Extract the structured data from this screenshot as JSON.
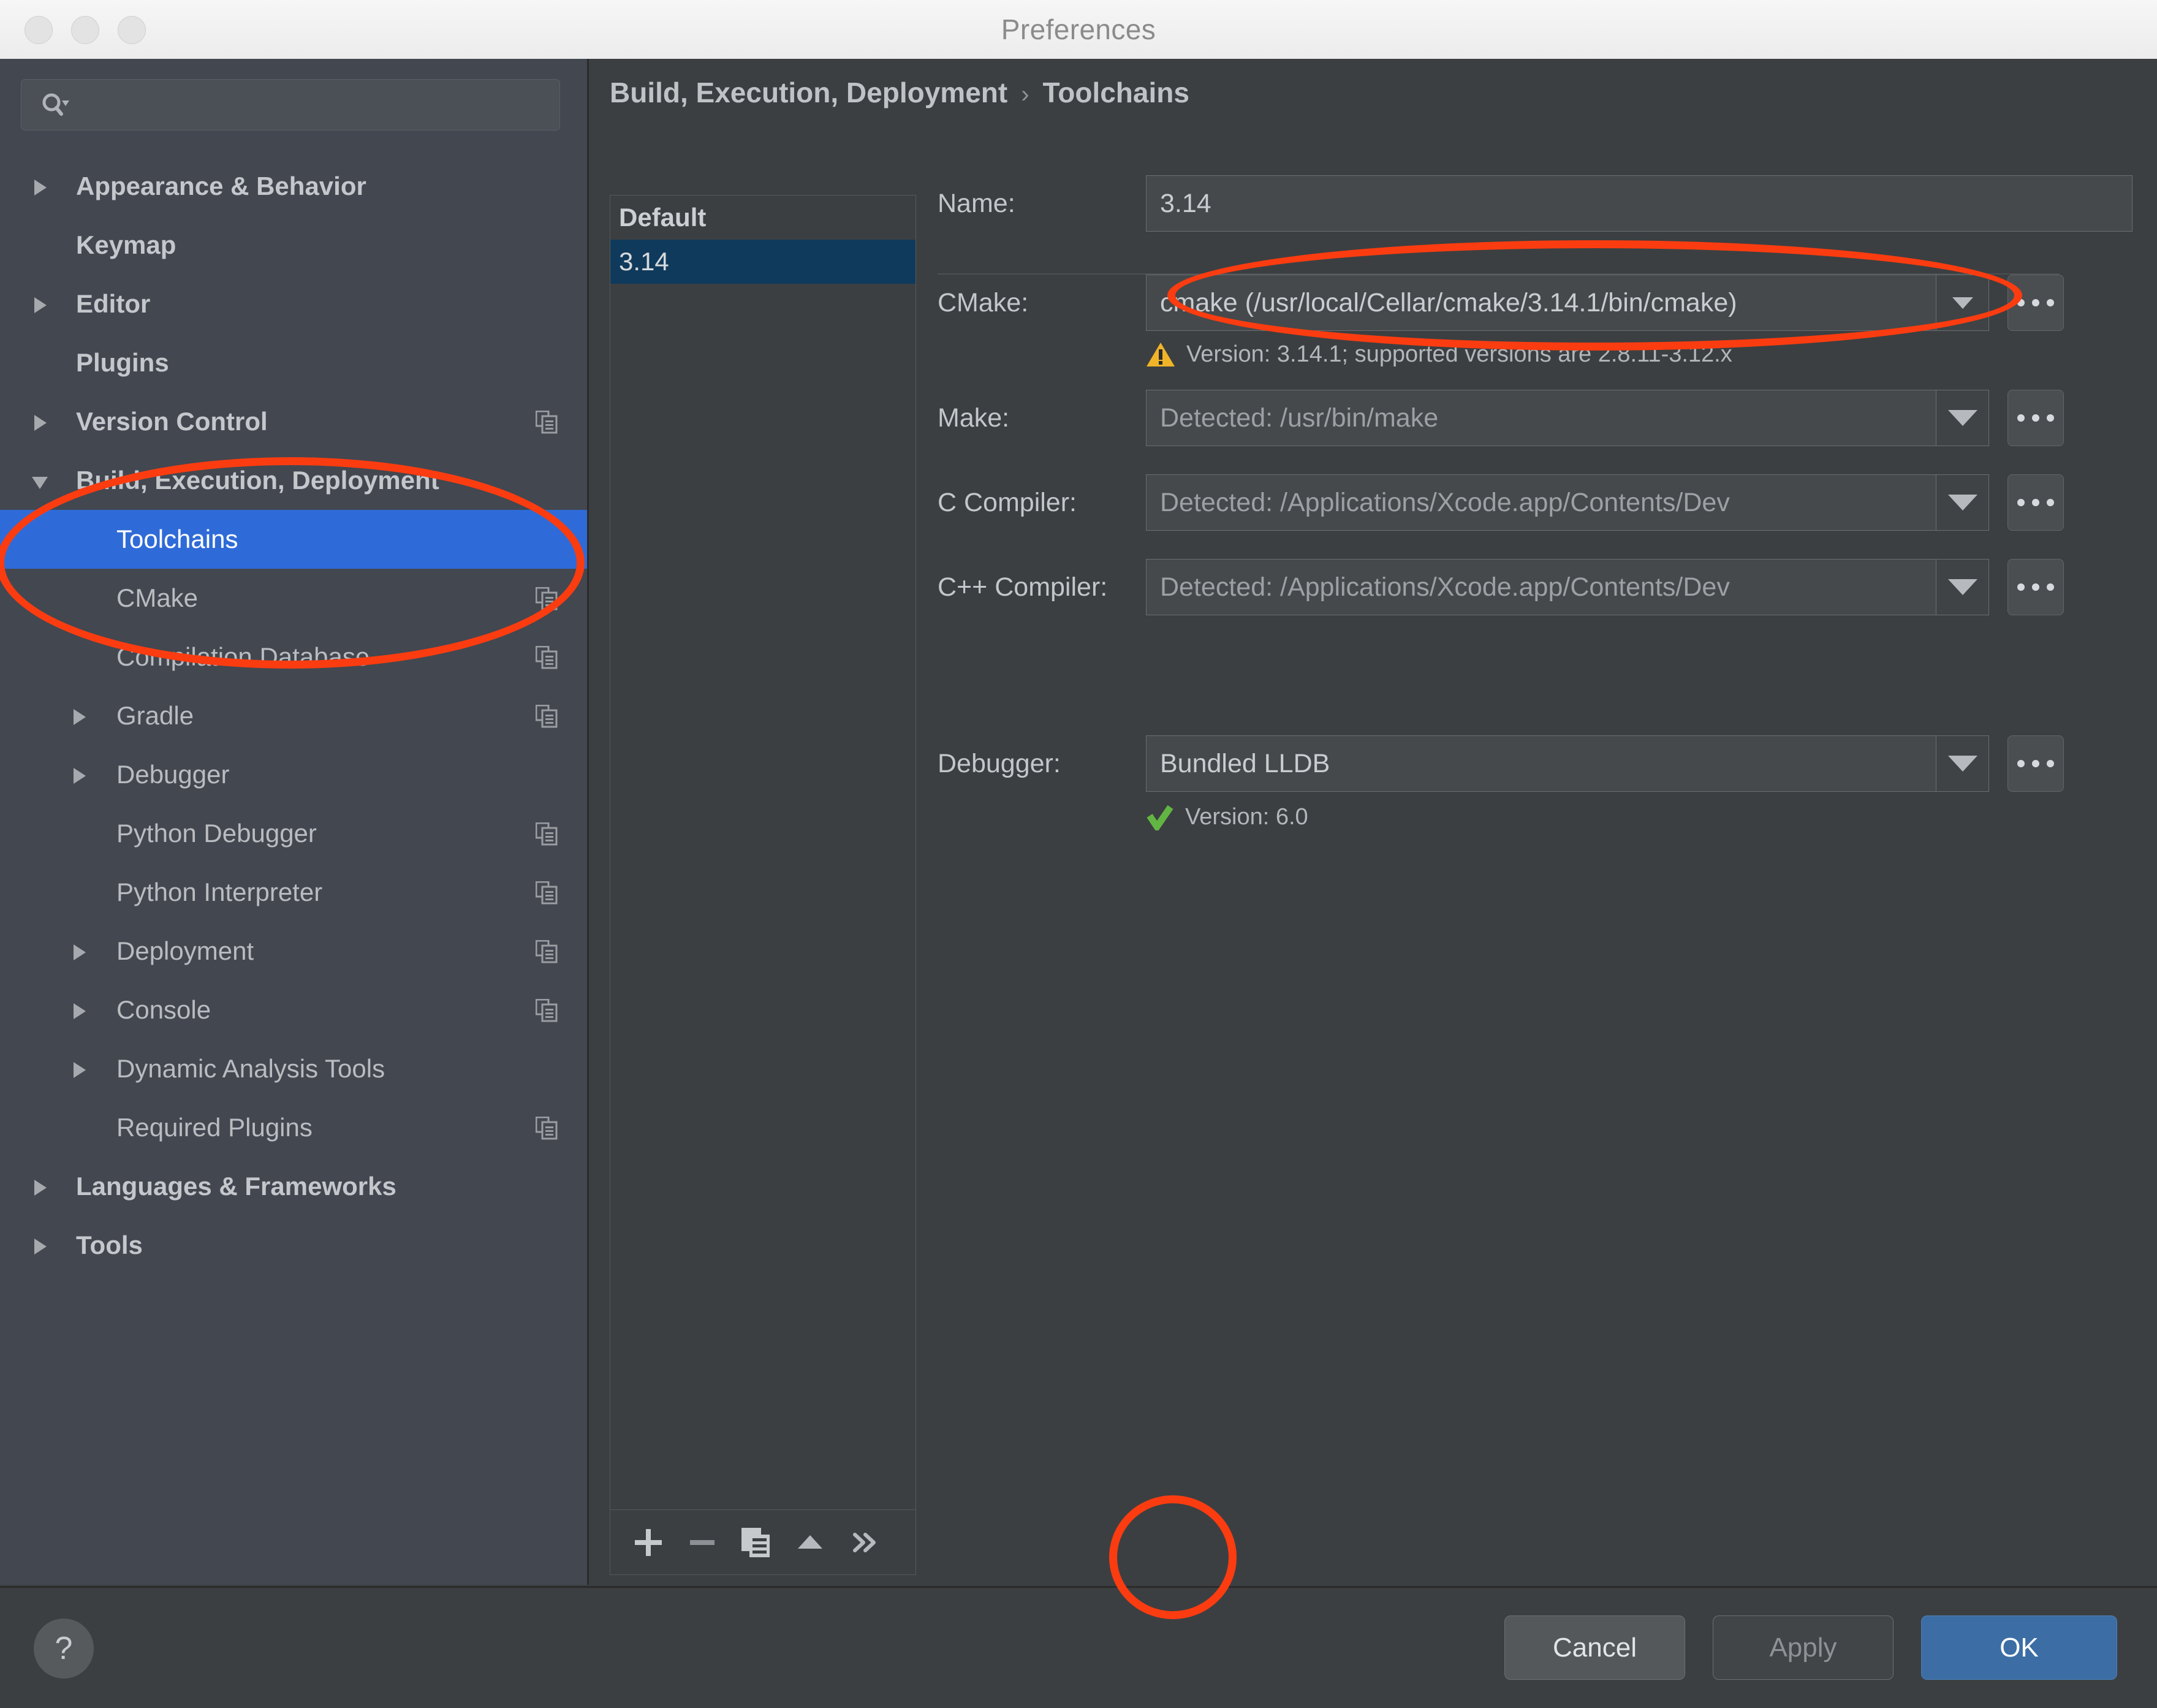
{
  "window": {
    "title": "Preferences",
    "traffic_lights": [
      "close",
      "minimize",
      "zoom"
    ]
  },
  "search": {
    "value": "",
    "placeholder": ""
  },
  "sidebar": {
    "items": [
      {
        "label": "Appearance & Behavior",
        "level": 0,
        "twisty": "collapsed",
        "bold": true,
        "copy_indicator": false,
        "selected": false
      },
      {
        "label": "Keymap",
        "level": 0,
        "twisty": "none",
        "bold": true,
        "copy_indicator": false,
        "selected": false
      },
      {
        "label": "Editor",
        "level": 0,
        "twisty": "collapsed",
        "bold": true,
        "copy_indicator": false,
        "selected": false
      },
      {
        "label": "Plugins",
        "level": 0,
        "twisty": "none",
        "bold": true,
        "copy_indicator": false,
        "selected": false
      },
      {
        "label": "Version Control",
        "level": 0,
        "twisty": "collapsed",
        "bold": true,
        "copy_indicator": true,
        "selected": false
      },
      {
        "label": "Build, Execution, Deployment",
        "level": 0,
        "twisty": "expanded",
        "bold": true,
        "copy_indicator": false,
        "selected": false
      },
      {
        "label": "Toolchains",
        "level": 1,
        "twisty": "none",
        "bold": false,
        "copy_indicator": false,
        "selected": true
      },
      {
        "label": "CMake",
        "level": 1,
        "twisty": "none",
        "bold": false,
        "copy_indicator": true,
        "selected": false
      },
      {
        "label": "Compilation Database",
        "level": 1,
        "twisty": "none",
        "bold": false,
        "copy_indicator": true,
        "selected": false
      },
      {
        "label": "Gradle",
        "level": 1,
        "twisty": "collapsed",
        "bold": false,
        "copy_indicator": true,
        "selected": false
      },
      {
        "label": "Debugger",
        "level": 1,
        "twisty": "collapsed",
        "bold": false,
        "copy_indicator": false,
        "selected": false
      },
      {
        "label": "Python Debugger",
        "level": 1,
        "twisty": "none",
        "bold": false,
        "copy_indicator": true,
        "selected": false
      },
      {
        "label": "Python Interpreter",
        "level": 1,
        "twisty": "none",
        "bold": false,
        "copy_indicator": true,
        "selected": false
      },
      {
        "label": "Deployment",
        "level": 1,
        "twisty": "collapsed",
        "bold": false,
        "copy_indicator": true,
        "selected": false
      },
      {
        "label": "Console",
        "level": 1,
        "twisty": "collapsed",
        "bold": false,
        "copy_indicator": true,
        "selected": false
      },
      {
        "label": "Dynamic Analysis Tools",
        "level": 1,
        "twisty": "collapsed",
        "bold": false,
        "copy_indicator": false,
        "selected": false
      },
      {
        "label": "Required Plugins",
        "level": 1,
        "twisty": "none",
        "bold": false,
        "copy_indicator": true,
        "selected": false
      },
      {
        "label": "Languages & Frameworks",
        "level": 0,
        "twisty": "collapsed",
        "bold": true,
        "copy_indicator": false,
        "selected": false
      },
      {
        "label": "Tools",
        "level": 0,
        "twisty": "collapsed",
        "bold": true,
        "copy_indicator": false,
        "selected": false
      }
    ]
  },
  "breadcrumb": {
    "parent": "Build, Execution, Deployment",
    "separator": "›",
    "current": "Toolchains"
  },
  "toolchain_list": {
    "items": [
      {
        "label": "Default",
        "is_default": true,
        "selected": false
      },
      {
        "label": "3.14",
        "is_default": false,
        "selected": true
      }
    ],
    "toolbar": [
      {
        "name": "add",
        "glyph": "+"
      },
      {
        "name": "remove",
        "glyph": "−"
      },
      {
        "name": "copy",
        "glyph": "copy"
      },
      {
        "name": "move-up",
        "glyph": "▲"
      },
      {
        "name": "more",
        "glyph": "»"
      }
    ]
  },
  "form": {
    "name": {
      "label": "Name:",
      "value": "3.14"
    },
    "cmake": {
      "label": "CMake:",
      "value": "cmake (/usr/local/Cellar/cmake/3.14.1/bin/cmake)",
      "browse_label": "...",
      "status": {
        "icon": "warning-triangle-icon",
        "text": "Version: 3.14.1; supported versions are 2.8.11-3.12.x",
        "color": "#f0b429"
      }
    },
    "make": {
      "label": "Make:",
      "value": "Detected: /usr/bin/make",
      "is_placeholder": true,
      "browse_label": "..."
    },
    "c_compiler": {
      "label": "C Compiler:",
      "value": "Detected: /Applications/Xcode.app/Contents/Dev",
      "is_placeholder": true,
      "browse_label": "..."
    },
    "cpp_compiler": {
      "label": "C++ Compiler:",
      "value": "Detected: /Applications/Xcode.app/Contents/Dev",
      "is_placeholder": true,
      "browse_label": "..."
    },
    "debugger": {
      "label": "Debugger:",
      "value": "Bundled LLDB",
      "browse_label": "...",
      "status": {
        "icon": "check-icon",
        "text": "Version: 6.0",
        "color": "#62b543"
      }
    }
  },
  "footer": {
    "help_label": "?",
    "cancel_label": "Cancel",
    "apply_label": "Apply",
    "ok_label": "OK"
  },
  "annotations": {
    "color": "#fa3c10",
    "shapes": [
      {
        "name": "toolchains-highlight",
        "shape": "ellipse"
      },
      {
        "name": "cmake-field-highlight",
        "shape": "ellipse"
      },
      {
        "name": "add-button-highlight",
        "shape": "ellipse"
      }
    ]
  },
  "colors": {
    "window_bg": "#3c3f41",
    "sidebar_bg": "#434750",
    "selection_blue": "#2f6bd8",
    "list_selection": "#103a5c",
    "ok_button": "#3c6ea5",
    "warning": "#f0b429",
    "ok_status": "#62b543",
    "annotation_red": "#fa3c10"
  }
}
